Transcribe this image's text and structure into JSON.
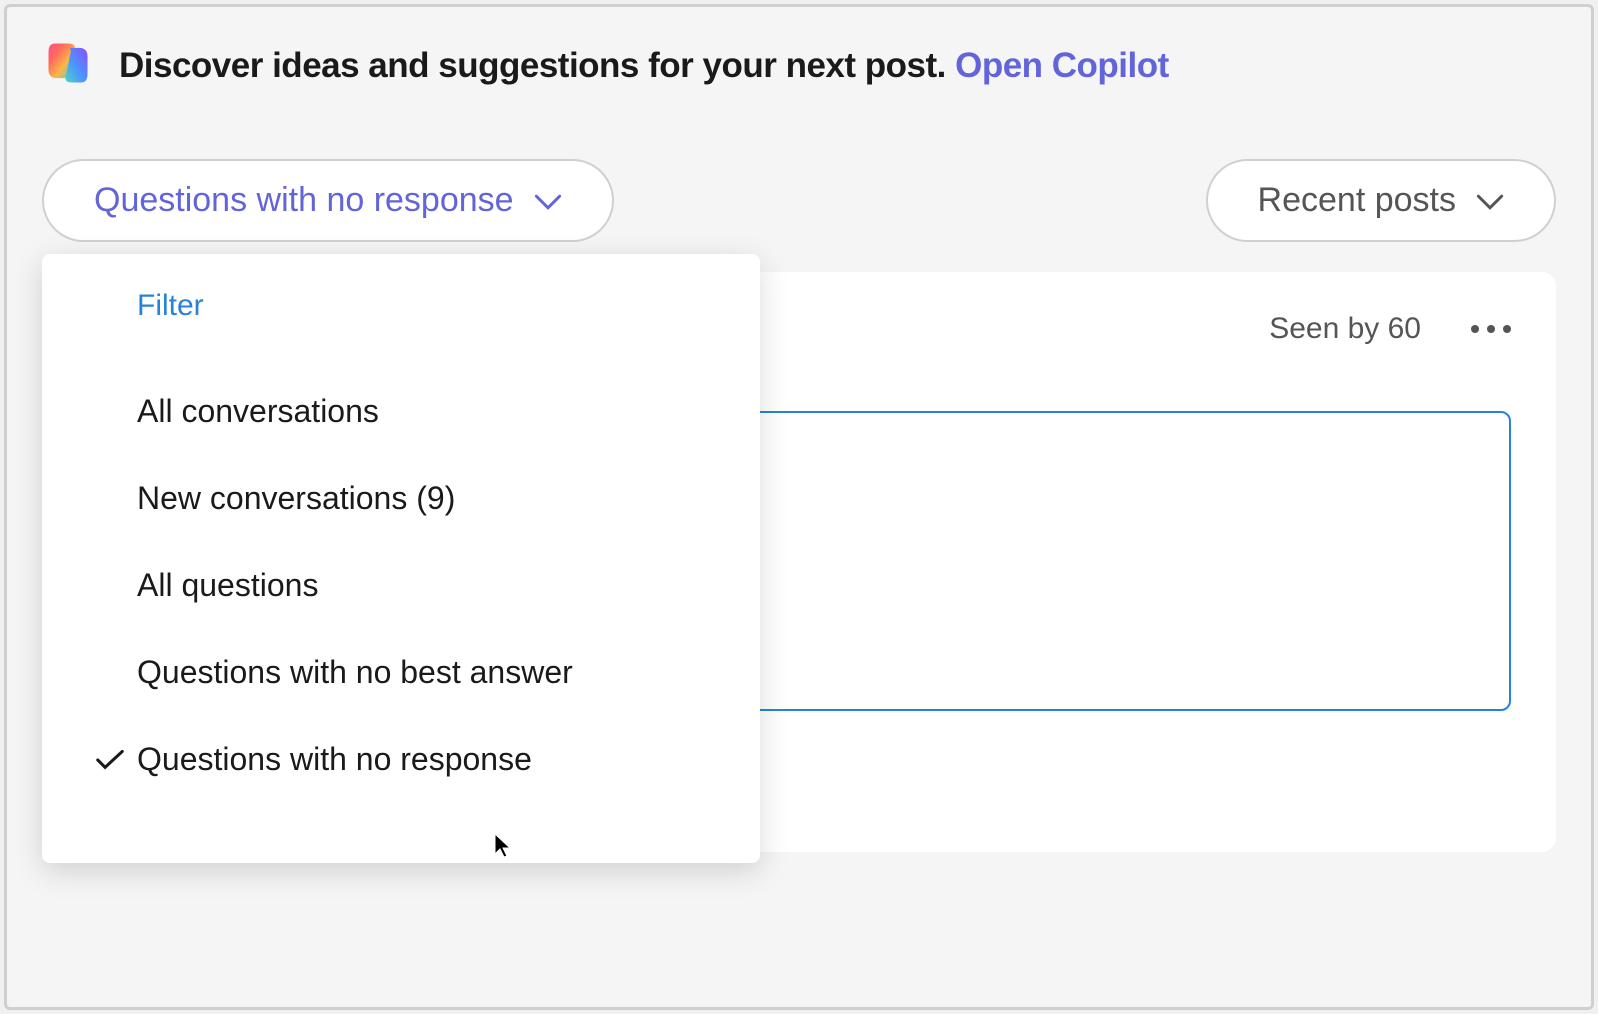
{
  "banner": {
    "text": "Discover ideas and suggestions for your next post. ",
    "link_text": "Open Copilot"
  },
  "filters": {
    "left_pill": "Questions with no response",
    "right_pill": "Recent posts"
  },
  "dropdown": {
    "header": "Filter",
    "items": [
      {
        "label": "All conversations",
        "checked": false
      },
      {
        "label": "New conversations (9)",
        "checked": false
      },
      {
        "label": "All questions",
        "checked": false
      },
      {
        "label": "Questions with no best answer",
        "checked": false
      },
      {
        "label": "Questions with no response",
        "checked": true
      }
    ]
  },
  "post": {
    "seen_by": "Seen by 60"
  }
}
